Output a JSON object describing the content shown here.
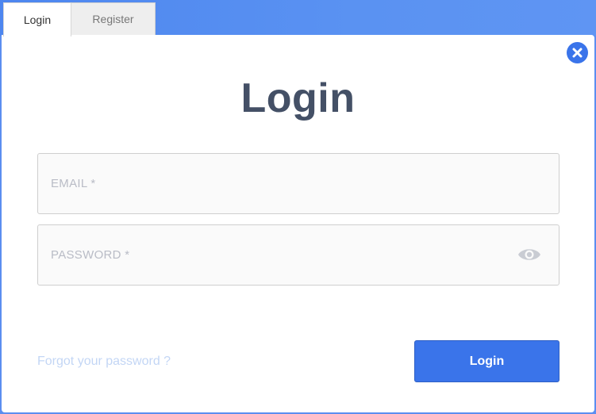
{
  "tabs": [
    {
      "label": "Login",
      "active": true
    },
    {
      "label": "Register",
      "active": false
    }
  ],
  "modal": {
    "title": "Login",
    "close_icon": "close-icon"
  },
  "form": {
    "email": {
      "value": "",
      "placeholder": "EMAIL *"
    },
    "password": {
      "value": "",
      "placeholder": "PASSWORD *",
      "toggle_icon": "eye-icon"
    },
    "forgot_link": "Forgot your password ?",
    "submit_label": "Login"
  },
  "colors": {
    "accent": "#3a74ea",
    "backdrop": "#5b8ef0",
    "title": "#445066",
    "link": "#c3d6f5",
    "placeholder": "#b9bcc6"
  }
}
